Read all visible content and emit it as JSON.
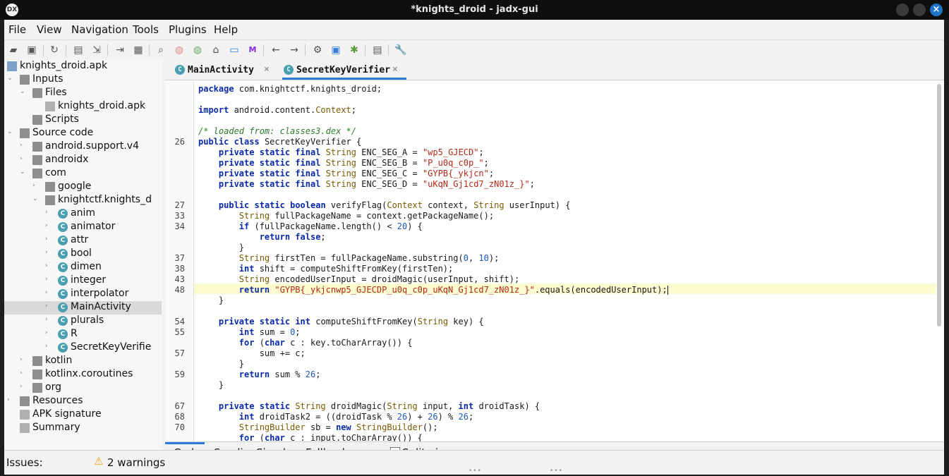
{
  "window": {
    "title": "*knights_droid - jadx-gui",
    "app_icon": "jadx-logo-icon"
  },
  "menu": [
    "File",
    "View",
    "Navigation",
    "Tools",
    "Plugins",
    "Help"
  ],
  "toolbar_icons": [
    "open-file-icon",
    "add-files-icon",
    "sync-icon",
    "save-all-icon",
    "export-icon",
    "sync-tree-icon",
    "flatten-icon",
    "search-icon",
    "find-class-icon",
    "find-usage-icon",
    "home-icon",
    "log-viewer-icon",
    "smali-icon",
    "back-icon",
    "forward-icon",
    "deobfuscation-icon",
    "quark-icon",
    "debug-icon",
    "log-icon",
    "preferences-icon"
  ],
  "tree": {
    "root": "knights_droid.apk",
    "items": [
      {
        "label": "knights_droid.apk"
      },
      {
        "label": "Inputs"
      },
      {
        "label": "Files"
      },
      {
        "label": "knights_droid.apk"
      },
      {
        "label": "Scripts"
      },
      {
        "label": "Source code"
      },
      {
        "label": "android.support.v4"
      },
      {
        "label": "androidx"
      },
      {
        "label": "com"
      },
      {
        "label": "google"
      },
      {
        "label": "knightctf.knights_d"
      },
      {
        "label": "anim"
      },
      {
        "label": "animator"
      },
      {
        "label": "attr"
      },
      {
        "label": "bool"
      },
      {
        "label": "dimen"
      },
      {
        "label": "integer"
      },
      {
        "label": "interpolator"
      },
      {
        "label": "MainActivity"
      },
      {
        "label": "plurals"
      },
      {
        "label": "R"
      },
      {
        "label": "SecretKeyVerifie"
      },
      {
        "label": "kotlin"
      },
      {
        "label": "kotlinx.coroutines"
      },
      {
        "label": "org"
      },
      {
        "label": "Resources"
      },
      {
        "label": "APK signature"
      },
      {
        "label": "Summary"
      }
    ]
  },
  "tabs": [
    {
      "label": "MainActivity",
      "close": "×",
      "icon": "class-icon"
    },
    {
      "label": "SecretKeyVerifier",
      "close": "×",
      "icon": "class-icon"
    }
  ],
  "code": {
    "line_numbers": [
      "",
      "",
      "",
      "",
      "",
      "26",
      "",
      "",
      "",
      "",
      "",
      "27",
      "33",
      "34",
      "",
      "",
      "37",
      "38",
      "43",
      "48",
      "",
      "",
      "54",
      "55",
      "",
      "57",
      "",
      "59",
      "",
      "",
      "67",
      "68",
      "70",
      ""
    ],
    "lines": [
      "package com.knightctf.knights_droid;",
      "",
      "import android.content.Context;",
      "",
      "/* loaded from: classes3.dex */",
      "public class SecretKeyVerifier {",
      "    private static final String ENC_SEG_A = \"wp5_GJECD\";",
      "    private static final String ENC_SEG_B = \"P_u0q_c0p_\";",
      "    private static final String ENC_SEG_C = \"GYPB{_ykjcn\";",
      "    private static final String ENC_SEG_D = \"uKqN_Gj1cd7_zN01z_}\";",
      "",
      "    public static boolean verifyFlag(Context context, String userInput) {",
      "        String fullPackageName = context.getPackageName();",
      "        if (fullPackageName.length() < 20) {",
      "            return false;",
      "        }",
      "        String firstTen = fullPackageName.substring(0, 10);",
      "        int shift = computeShiftFromKey(firstTen);",
      "        String encodedUserInput = droidMagic(userInput, shift);",
      "        return \"GYPB{_ykjcnwp5_GJECDP_u0q_c0p_uKqN_Gj1cd7_zN01z_}\".equals(encodedUserInput);",
      "    }",
      "",
      "    private static int computeShiftFromKey(String key) {",
      "        int sum = 0;",
      "        for (char c : key.toCharArray()) {",
      "            sum += c;",
      "        }",
      "        return sum % 26;",
      "    }",
      "",
      "    private static String droidMagic(String input, int droidTask) {",
      "        int droidTask2 = ((droidTask % 26) + 26) % 26;",
      "        StringBuilder sb = new StringBuilder();",
      "        for (char c : input.toCharArray()) {"
    ]
  },
  "bottom_tabs": [
    "Code",
    "Smali",
    "Simple",
    "Fallback"
  ],
  "split_view_label": "Split view",
  "status": {
    "issues_label": "Issues:",
    "warnings": "2 warnings"
  }
}
